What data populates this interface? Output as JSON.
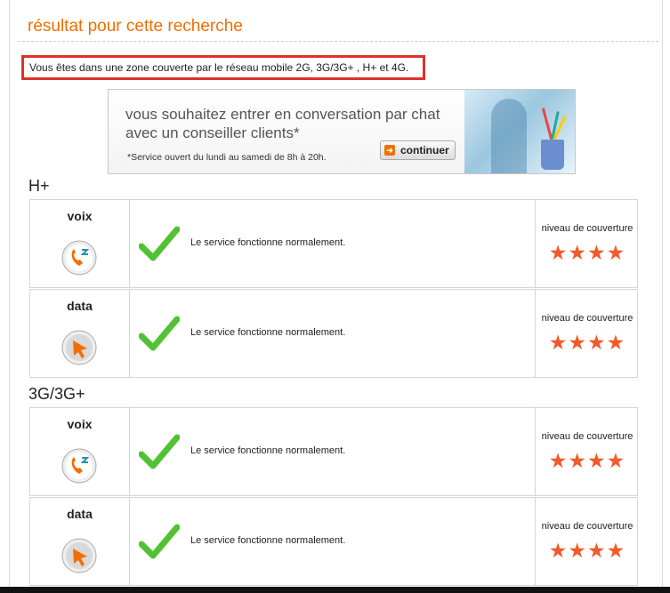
{
  "title": "résultat pour cette recherche",
  "coverage_notice": "Vous êtes dans une zone couverte par le réseau mobile 2G, 3G/3G+ , H+ et 4G.",
  "promo": {
    "line1": "vous souhaitez entrer en conversation par chat",
    "line2": "avec un conseiller clients*",
    "note": "*Service ouvert du lundi au samedi de 8h à 20h.",
    "button_label": "continuer"
  },
  "sections": [
    {
      "heading": "H+",
      "rows": [
        {
          "service": "voix",
          "icon": "phone-icon",
          "status": "Le service fonctionne normalement.",
          "coverage_label": "niveau de couverture",
          "stars": "★★★★",
          "rating": 4
        },
        {
          "service": "data",
          "icon": "cursor-globe-icon",
          "status": "Le service fonctionne normalement.",
          "coverage_label": "niveau de couverture",
          "stars": "★★★★",
          "rating": 4
        }
      ]
    },
    {
      "heading": "3G/3G+",
      "rows": [
        {
          "service": "voix",
          "icon": "phone-icon",
          "status": "Le service fonctionne normalement.",
          "coverage_label": "niveau de couverture",
          "stars": "★★★★",
          "rating": 4
        },
        {
          "service": "data",
          "icon": "cursor-globe-icon",
          "status": "Le service fonctionne normalement.",
          "coverage_label": "niveau de couverture",
          "stars": "★★★★",
          "rating": 4
        }
      ]
    }
  ],
  "colors": {
    "accent": "#f16e00",
    "star": "#f15a2b",
    "check": "#52c234",
    "highlight_border": "#e0312b"
  }
}
